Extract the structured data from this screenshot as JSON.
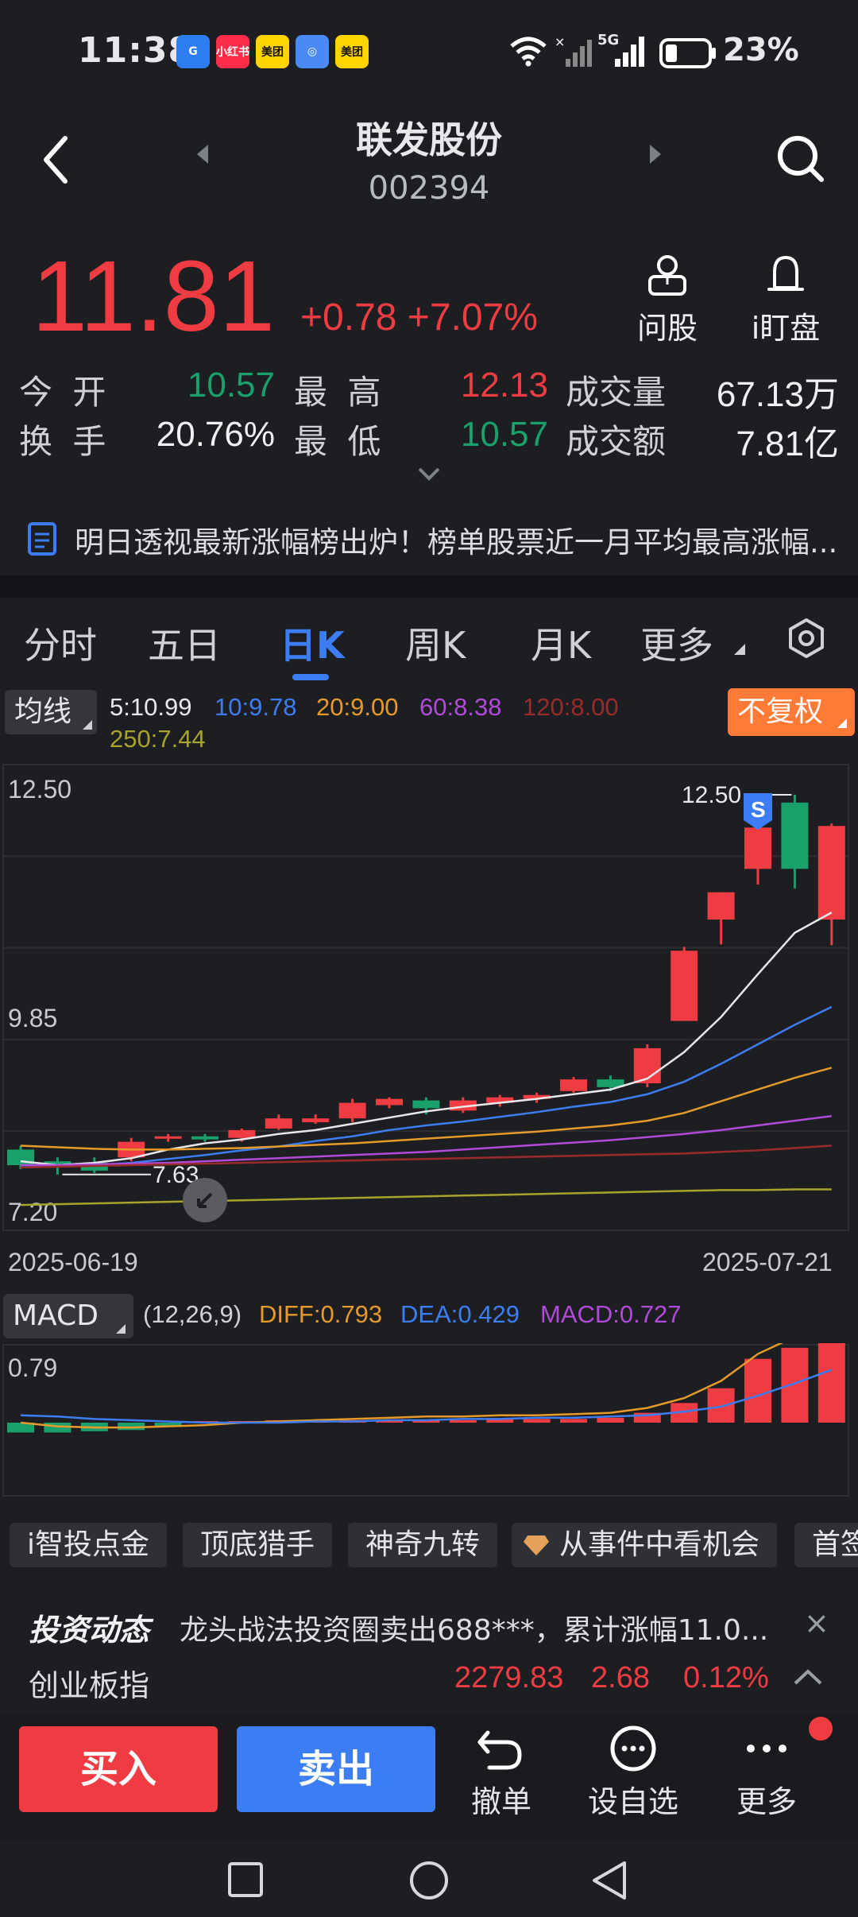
{
  "status_bar": {
    "time": "11:38",
    "apps": [
      {
        "name": "app-icon-1",
        "bg": "#2e7df0",
        "label": "G"
      },
      {
        "name": "app-icon-2",
        "bg": "#ff2d4a",
        "label": "小红书"
      },
      {
        "name": "app-icon-3",
        "bg": "#ffd400",
        "label": "美团"
      },
      {
        "name": "app-icon-4",
        "bg": "#4a8af6",
        "label": "◎"
      },
      {
        "name": "app-icon-5",
        "bg": "#ffd400",
        "label": "美团"
      }
    ],
    "network": "5G",
    "battery": "23%"
  },
  "header": {
    "title": "联发股份",
    "code": "002394"
  },
  "quote": {
    "price": "11.81",
    "change": "+0.78 +7.07%",
    "ask_label": "问股",
    "watch_label": "i盯盘",
    "rows": [
      {
        "l1": "今 开",
        "v1": "10.57",
        "c1": "green",
        "l2": "最 高",
        "v2": "12.13",
        "c2": "red",
        "l3": "成交量",
        "v3": "67.13万",
        "c3": "white"
      },
      {
        "l1": "换 手",
        "v1": "20.76%",
        "c1": "white",
        "l2": "最 低",
        "v2": "10.57",
        "c2": "green",
        "l3": "成交额",
        "v3": "7.81亿",
        "c3": "white"
      }
    ]
  },
  "news": {
    "text": "明日透视最新涨幅榜出炉！榜单股票近一月平均最高涨幅..."
  },
  "tabs": [
    "分时",
    "五日",
    "日K",
    "周K",
    "月K",
    "更多"
  ],
  "active_tab": "日K",
  "ma": {
    "select_label": "均线",
    "items": [
      {
        "text": "5:10.99",
        "color": "#e8e8ea"
      },
      {
        "text": "10:9.78",
        "color": "#3d7df3"
      },
      {
        "text": "20:9.00",
        "color": "#e59a2a"
      },
      {
        "text": "60:8.38",
        "color": "#b04ad8"
      },
      {
        "text": "120:8.00",
        "color": "#9a2b2b"
      },
      {
        "text": "250:7.44",
        "color": "#a8a32a"
      }
    ],
    "adjust_label": "不复权"
  },
  "kline": {
    "y_labels": [
      "12.50",
      "9.85",
      "7.20"
    ],
    "high_marker": "12.50",
    "low_marker": "7.63",
    "signal_badge": "S",
    "date_start": "2025-06-19",
    "date_end": "2025-07-21"
  },
  "chart_data": {
    "type": "candlestick",
    "x_range": [
      "2025-06-19",
      "2025-07-21"
    ],
    "ylim": [
      7.2,
      12.5
    ],
    "candles": [
      {
        "o": 7.95,
        "c": 7.75,
        "h": 8.0,
        "l": 7.7
      },
      {
        "o": 7.8,
        "c": 7.72,
        "h": 7.85,
        "l": 7.63
      },
      {
        "o": 7.78,
        "c": 7.68,
        "h": 7.85,
        "l": 7.65
      },
      {
        "o": 7.85,
        "c": 8.05,
        "h": 8.1,
        "l": 7.8
      },
      {
        "o": 8.1,
        "c": 8.12,
        "h": 8.15,
        "l": 8.05
      },
      {
        "o": 8.12,
        "c": 8.08,
        "h": 8.15,
        "l": 8.05
      },
      {
        "o": 8.1,
        "c": 8.2,
        "h": 8.22,
        "l": 8.05
      },
      {
        "o": 8.22,
        "c": 8.35,
        "h": 8.4,
        "l": 8.2
      },
      {
        "o": 8.3,
        "c": 8.35,
        "h": 8.4,
        "l": 8.28
      },
      {
        "o": 8.35,
        "c": 8.55,
        "h": 8.6,
        "l": 8.3
      },
      {
        "o": 8.52,
        "c": 8.6,
        "h": 8.62,
        "l": 8.48
      },
      {
        "o": 8.58,
        "c": 8.48,
        "h": 8.62,
        "l": 8.4
      },
      {
        "o": 8.45,
        "c": 8.58,
        "h": 8.62,
        "l": 8.42
      },
      {
        "o": 8.55,
        "c": 8.62,
        "h": 8.65,
        "l": 8.5
      },
      {
        "o": 8.6,
        "c": 8.65,
        "h": 8.68,
        "l": 8.55
      },
      {
        "o": 8.7,
        "c": 8.85,
        "h": 8.88,
        "l": 8.68
      },
      {
        "o": 8.85,
        "c": 8.75,
        "h": 8.9,
        "l": 8.7
      },
      {
        "o": 8.8,
        "c": 9.25,
        "h": 9.3,
        "l": 8.75
      },
      {
        "o": 9.6,
        "c": 10.5,
        "h": 10.55,
        "l": 9.6
      },
      {
        "o": 10.9,
        "c": 11.25,
        "h": 11.25,
        "l": 10.58
      },
      {
        "o": 11.55,
        "c": 12.08,
        "h": 12.08,
        "l": 11.35
      },
      {
        "o": 12.4,
        "c": 11.55,
        "h": 12.5,
        "l": 11.3
      },
      {
        "o": 10.9,
        "c": 12.1,
        "h": 12.13,
        "l": 10.57
      }
    ],
    "ma_lines": {
      "ma5": [
        7.8,
        7.75,
        7.78,
        7.84,
        7.95,
        8.03,
        8.08,
        8.15,
        8.2,
        8.28,
        8.36,
        8.44,
        8.5,
        8.55,
        8.6,
        8.66,
        8.72,
        8.86,
        9.2,
        9.65,
        10.2,
        10.73,
        10.99
      ],
      "ma10": [
        7.75,
        7.74,
        7.75,
        7.78,
        7.83,
        7.88,
        7.94,
        7.99,
        8.06,
        8.12,
        8.2,
        8.26,
        8.31,
        8.37,
        8.43,
        8.5,
        8.56,
        8.66,
        8.82,
        9.05,
        9.3,
        9.55,
        9.78
      ],
      "ma20": [
        8.0,
        7.98,
        7.96,
        7.95,
        7.95,
        7.96,
        7.97,
        7.99,
        8.01,
        8.03,
        8.06,
        8.09,
        8.12,
        8.15,
        8.18,
        8.22,
        8.26,
        8.32,
        8.42,
        8.57,
        8.72,
        8.87,
        9.0
      ],
      "ma60": [
        7.75,
        7.75,
        7.76,
        7.77,
        7.78,
        7.8,
        7.82,
        7.84,
        7.86,
        7.88,
        7.9,
        7.92,
        7.95,
        7.98,
        8.01,
        8.04,
        8.07,
        8.11,
        8.15,
        8.2,
        8.26,
        8.32,
        8.38
      ],
      "ma120": [
        7.72,
        7.73,
        7.74,
        7.75,
        7.76,
        7.77,
        7.78,
        7.79,
        7.8,
        7.81,
        7.82,
        7.83,
        7.84,
        7.85,
        7.86,
        7.87,
        7.88,
        7.89,
        7.9,
        7.92,
        7.94,
        7.97,
        8.0
      ],
      "ma250": [
        7.24,
        7.25,
        7.26,
        7.27,
        7.28,
        7.29,
        7.3,
        7.31,
        7.32,
        7.33,
        7.34,
        7.35,
        7.36,
        7.37,
        7.38,
        7.39,
        7.4,
        7.41,
        7.42,
        7.43,
        7.43,
        7.44,
        7.44
      ]
    }
  },
  "macd": {
    "select_label": "MACD",
    "params": "(12,26,9)",
    "diff": "DIFF:0.793",
    "dea": "DEA:0.429",
    "macd": "MACD:0.727",
    "y_label": "0.79",
    "colors": {
      "diff": "#e59a2a",
      "dea": "#3d7df3",
      "macd": "#b04ad8"
    },
    "hist": [
      -0.08,
      -0.08,
      -0.07,
      -0.06,
      -0.03,
      0.0,
      0.01,
      0.02,
      0.02,
      0.02,
      0.02,
      0.02,
      0.02,
      0.03,
      0.03,
      0.03,
      0.04,
      0.08,
      0.16,
      0.28,
      0.52,
      0.61,
      0.73
    ],
    "diff_line": [
      0.0,
      -0.03,
      -0.04,
      -0.04,
      -0.03,
      -0.02,
      0.0,
      0.01,
      0.02,
      0.03,
      0.04,
      0.05,
      0.05,
      0.06,
      0.06,
      0.07,
      0.08,
      0.12,
      0.2,
      0.34,
      0.56,
      0.7,
      0.79
    ],
    "dea_line": [
      0.06,
      0.05,
      0.03,
      0.02,
      0.01,
      0.0,
      0.0,
      0.0,
      0.01,
      0.01,
      0.02,
      0.02,
      0.03,
      0.03,
      0.04,
      0.04,
      0.05,
      0.06,
      0.09,
      0.13,
      0.22,
      0.32,
      0.43
    ]
  },
  "chips": [
    "i智投点金",
    "顶底猎手",
    "神奇九转",
    "从事件中看机会",
    "首签"
  ],
  "invest": {
    "brand": "投资动态",
    "text": "龙头战法投资圈卖出688***，累计涨幅11.0...",
    "close": "×"
  },
  "index_bar": {
    "name": "创业板指",
    "value": "2279.83",
    "change": "2.68",
    "pct": "0.12%"
  },
  "toolbar": {
    "buy": "买入",
    "sell": "卖出",
    "cancel": "撤单",
    "set_watch": "设自选",
    "more": "更多"
  }
}
